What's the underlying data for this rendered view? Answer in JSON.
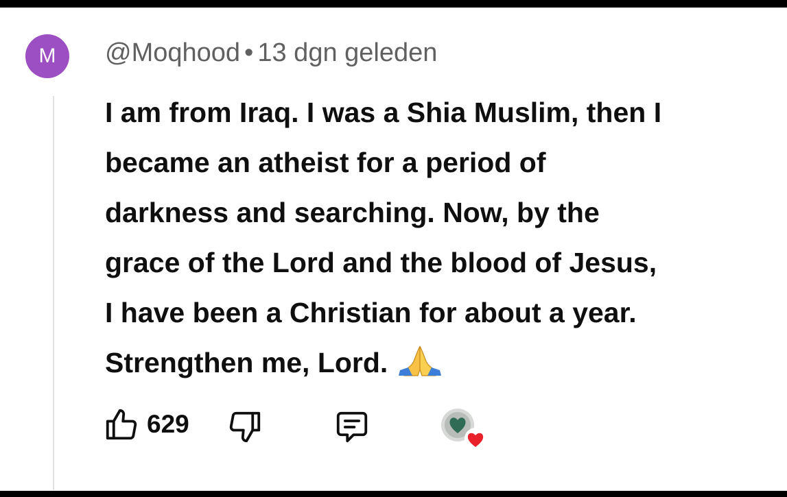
{
  "comment": {
    "avatar_letter": "M",
    "avatar_color": "#9c4fc3",
    "author": "@Moqhood",
    "separator": "•",
    "time": "13 dgn geleden",
    "text": "I am from Iraq. I was a Shia Muslim, then I\nbecame an atheist for a period of\ndarkness and searching. Now, by the\ngrace of the Lord and the blood of Jesus,\nI have been a Christian for about a year.\nStrengthen me, Lord.",
    "emoji": "folded-hands",
    "likes": "629"
  },
  "icons": {
    "like": "thumbs-up-icon",
    "dislike": "thumbs-down-icon",
    "reply": "comment-icon",
    "creator_heart": "creator-heart-icon"
  },
  "colors": {
    "heart": "#e8212a",
    "text": "#0f0f0f",
    "meta": "#606060"
  }
}
